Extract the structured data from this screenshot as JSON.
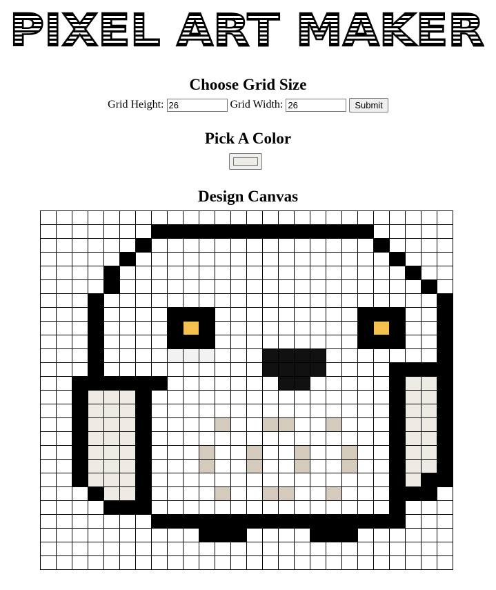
{
  "logo": {
    "text": "PIXEL ART MAKER"
  },
  "grid_form": {
    "title": "Choose Grid Size",
    "height_label": "Grid Height:",
    "height_value": "26",
    "width_label": "Grid Width:",
    "width_value": "26",
    "submit_label": "Submit"
  },
  "color_picker": {
    "title": "Pick A Color",
    "value": "#eeece6"
  },
  "canvas": {
    "title": "Design Canvas",
    "rows": 26,
    "cols": 26,
    "palette": {
      "K": "#000000",
      "k": "#111111",
      "Y": "#f2c14e",
      "E": "#edebe4",
      "e": "#f2f2f2",
      "T": "#d4cbbd"
    },
    "pixels": [
      "..........................",
      ".......KKKKKKKKKKKKKK.....",
      "......K..............K....",
      ".....K................K...",
      "....K..................K..",
      "....K...................K.",
      "...K.....................K",
      "...K....KKK.........KKK..K",
      "...K....KYK.........KYK..K",
      "...K....KKK.........KKK..K",
      "...K....eee...kkkk.......K",
      "...K..........kkkk....KKKK",
      "..KKKKKK.......kk.....KEEK",
      "..KEEEK...............KEEK",
      "..KEEEK...............KEEK",
      "..KEEEK....T..TT..T...KEEK",
      "..KEEEK...............KEEK",
      "..KEEEK...T..T..T..T..KEEK",
      "..KEEEK...T..T..T..T..KEEK",
      "..KEEEK...............KEKK",
      "...KEEK....T..TT..T...KKK.",
      "....KKK...............K...",
      ".......KKKKKKKKKKKKKKKK...",
      "..........KKK....KKK......",
      "..........................",
      ".........................."
    ]
  }
}
